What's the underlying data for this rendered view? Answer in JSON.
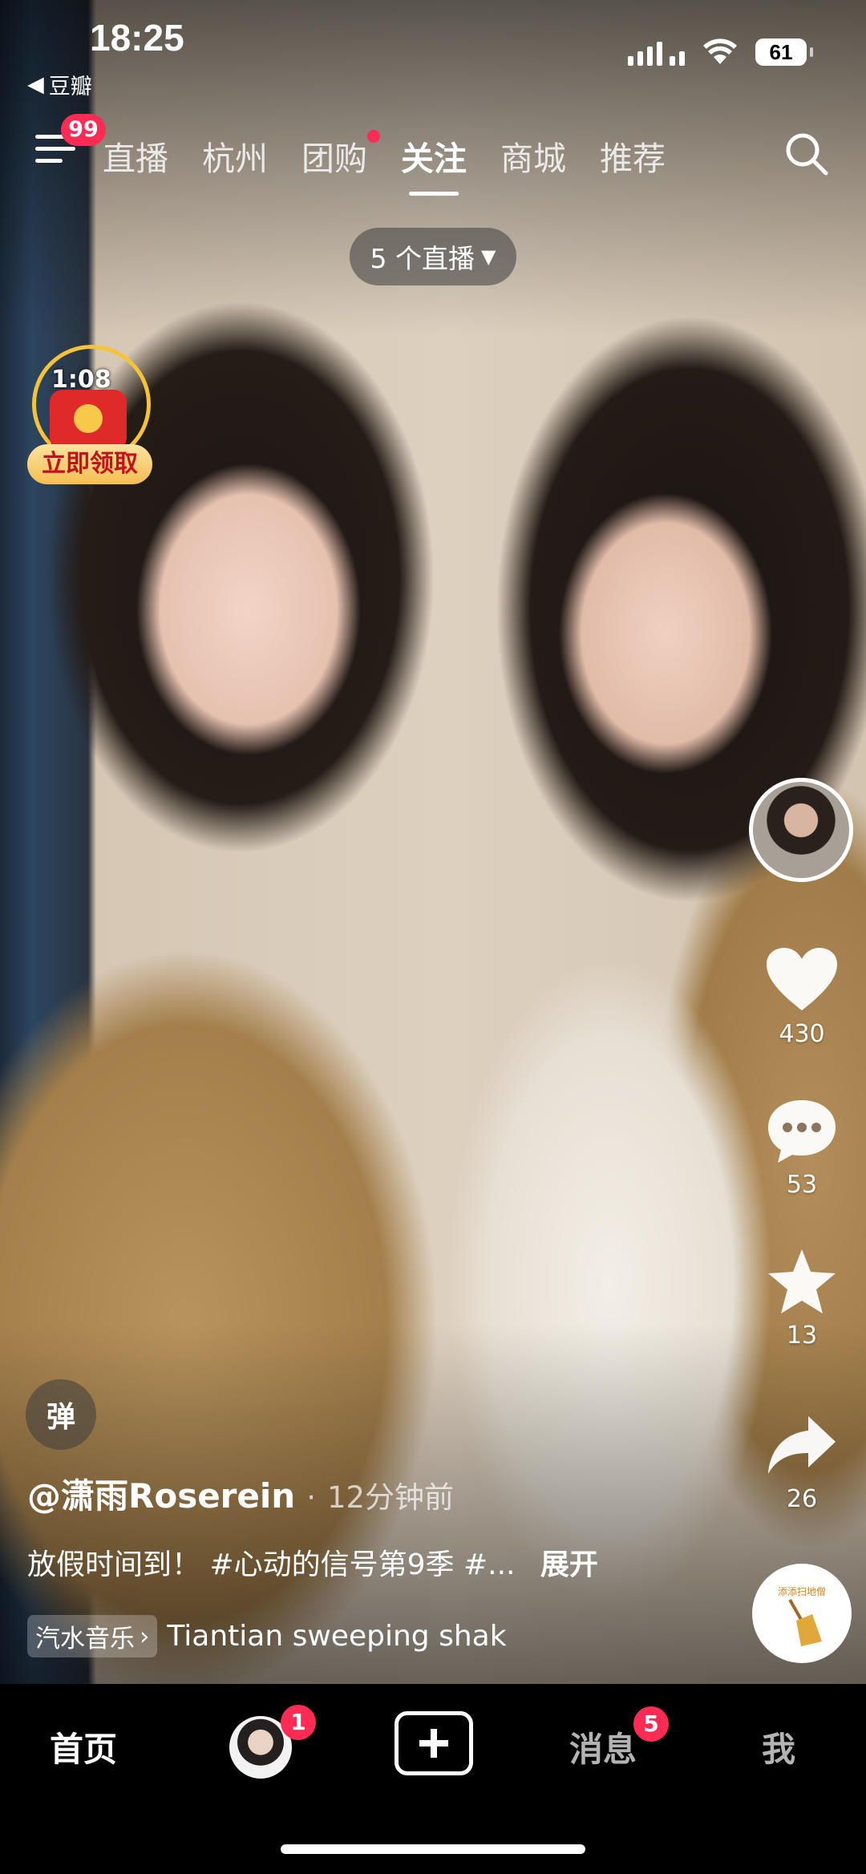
{
  "status_bar": {
    "time": "18:25",
    "back_app": "豆瓣",
    "battery": "61"
  },
  "top_nav": {
    "menu_badge": "99",
    "tabs": [
      {
        "label": "直播",
        "active": false
      },
      {
        "label": "杭州",
        "active": false
      },
      {
        "label": "团购",
        "active": false,
        "dot": true
      },
      {
        "label": "关注",
        "active": true
      },
      {
        "label": "商城",
        "active": false
      },
      {
        "label": "推荐",
        "active": false
      }
    ]
  },
  "live_pill": {
    "label": "5 个直播"
  },
  "red_packet": {
    "timer": "1:08",
    "label": "立即领取"
  },
  "right_rail": {
    "likes": "430",
    "comments": "53",
    "favorites": "13",
    "shares": "26",
    "music_disc_text": "添添扫地僧"
  },
  "post": {
    "danmu_label": "弹",
    "author": "@潇雨Roserein",
    "separator": "·",
    "posted": "12分钟前",
    "caption": "放假时间到！ #心动的信号第9季 #...",
    "expand": "展开",
    "music_tag": "汽水音乐",
    "music_title": "Tiantian sweeping shak"
  },
  "bottom_nav": {
    "home": "首页",
    "friend_badge": "1",
    "messages": "消息",
    "messages_badge": "5",
    "me": "我"
  },
  "colors": {
    "accent_red": "#fe2c55",
    "gold": "#f5c338"
  }
}
